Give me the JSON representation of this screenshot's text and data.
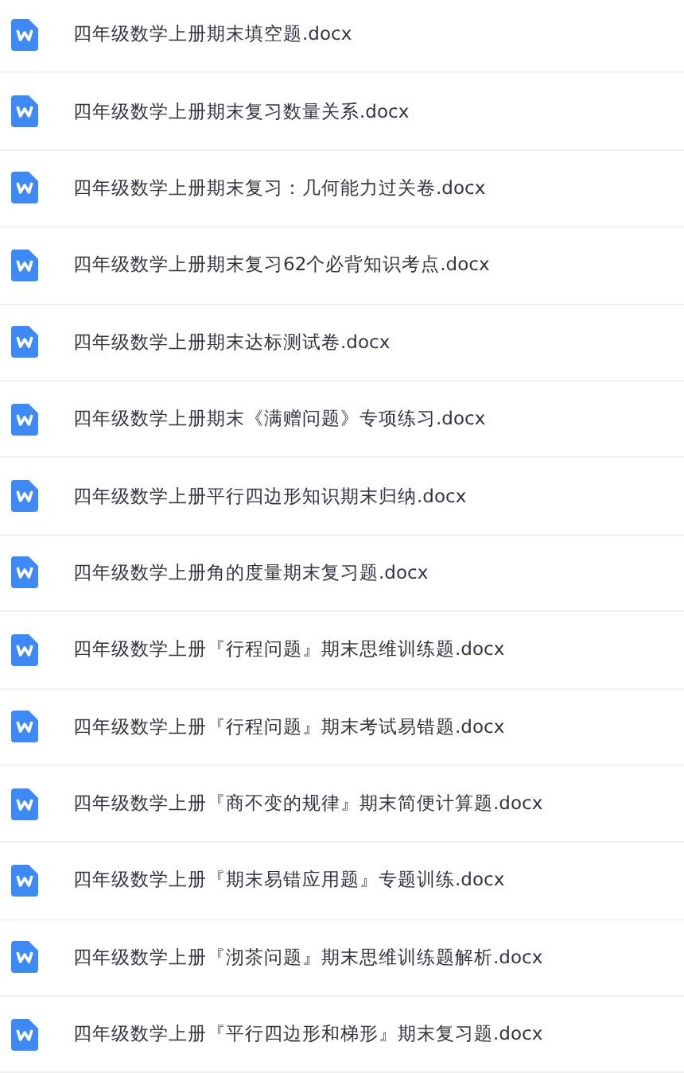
{
  "files": [
    {
      "name": "四年级数学上册期末填空题.docx"
    },
    {
      "name": "四年级数学上册期末复习数量关系.docx"
    },
    {
      "name": "四年级数学上册期末复习：几何能力过关卷.docx"
    },
    {
      "name": "四年级数学上册期末复习62个必背知识考点.docx"
    },
    {
      "name": "四年级数学上册期末达标测试卷.docx"
    },
    {
      "name": "四年级数学上册期末《满赠问题》专项练习.docx"
    },
    {
      "name": "四年级数学上册平行四边形知识期末归纳.docx"
    },
    {
      "name": "四年级数学上册角的度量期末复习题.docx"
    },
    {
      "name": "四年级数学上册『行程问题』期末思维训练题.docx"
    },
    {
      "name": "四年级数学上册『行程问题』期末考试易错题.docx"
    },
    {
      "name": "四年级数学上册『商不变的规律』期末简便计算题.docx"
    },
    {
      "name": "四年级数学上册『期末易错应用题』专题训练.docx"
    },
    {
      "name": "四年级数学上册『沏茶问题』期末思维训练题解析.docx"
    },
    {
      "name": "四年级数学上册『平行四边形和梯形』期末复习题.docx"
    }
  ]
}
